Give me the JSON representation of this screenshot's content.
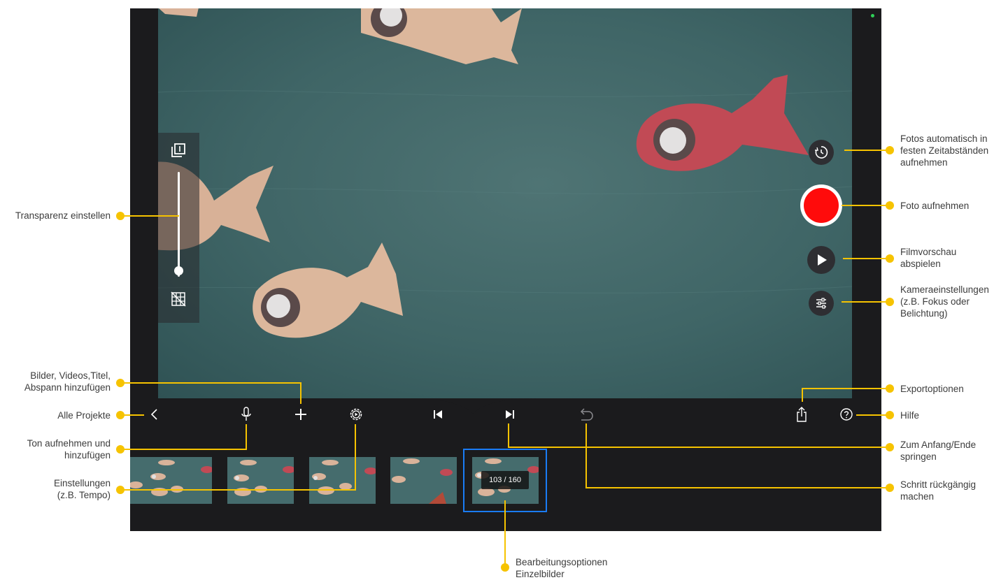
{
  "overlay": {
    "transparency_level": 0.06
  },
  "camera_controls": {
    "record_color": "#ff0b0b"
  },
  "filmstrip": {
    "frame_counter": "103 / 160",
    "selected_color": "#1a7cf5"
  },
  "toolbar": {
    "icons": [
      "chevron-left-icon",
      "microphone-icon",
      "plus-icon",
      "gear-icon",
      "skip-to-start-icon",
      "skip-to-end-icon",
      "undo-icon",
      "share-icon",
      "help-icon"
    ]
  },
  "annotations": {
    "accent_color": "#f6c300",
    "transparency": "Transparenz einstellen",
    "add_media_line1": "Bilder, Videos,Titel,",
    "add_media_line2": "Abspann hinzufügen",
    "all_projects": "Alle Projekte",
    "record_audio_line1": "Ton aufnehmen und",
    "record_audio_line2": "hinzufügen",
    "settings_line1": "Einstellungen",
    "settings_line2": "(z.B. Tempo)",
    "timelapse_line1": "Fotos automatisch in",
    "timelapse_line2": "festen Zeitabständen",
    "timelapse_line3": "aufnehmen",
    "take_photo": "Foto aufnehmen",
    "preview_line1": "Filmvorschau",
    "preview_line2": "abspielen",
    "camera_settings_line1": "Kameraeinstellungen",
    "camera_settings_line2": "(z.B. Fokus oder",
    "camera_settings_line3": "Belichtung)",
    "export": "Exportoptionen",
    "help": "Hilfe",
    "jump_line1": "Zum Anfang/Ende",
    "jump_line2": "springen",
    "undo_line1": "Schritt rückgängig",
    "undo_line2": "machen",
    "edit_frames_line1": "Bearbeitungsoptionen",
    "edit_frames_line2": "Einzelbilder"
  }
}
